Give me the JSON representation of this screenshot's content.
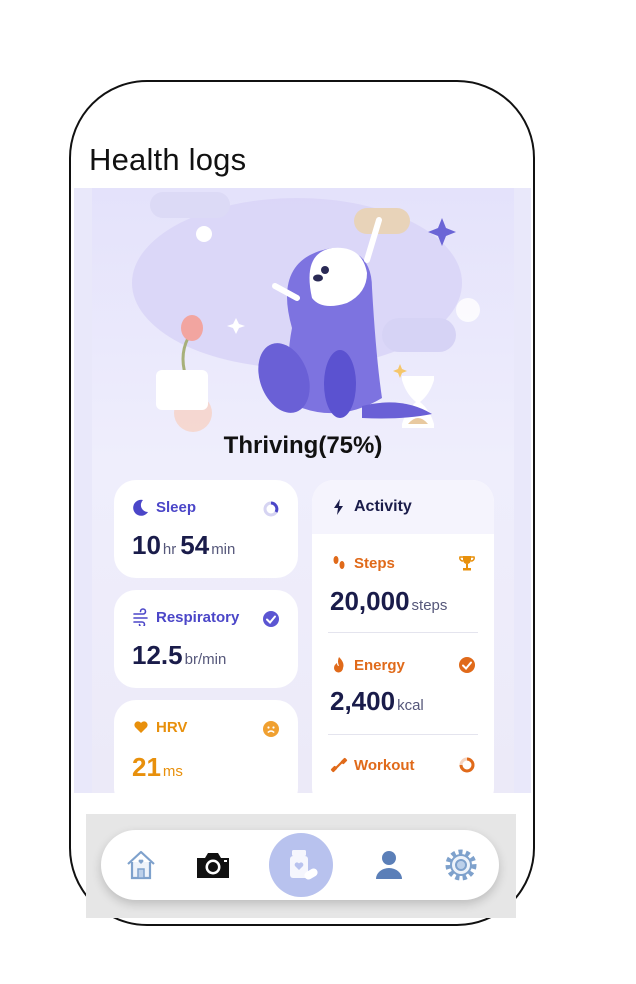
{
  "page": {
    "title": "Health logs"
  },
  "hero": {
    "status": "Thriving(75%)"
  },
  "cards": {
    "sleep": {
      "label": "Sleep",
      "hours": "10",
      "hours_unit": "hr",
      "minutes": "54",
      "minutes_unit": "min",
      "color": "#4b46c8"
    },
    "respiratory": {
      "label": "Respiratory",
      "value": "12.5",
      "unit": "br/min",
      "color": "#4b46c8"
    },
    "hrv": {
      "label": "HRV",
      "value": "21",
      "unit": "ms",
      "color": "#e8900c"
    }
  },
  "activity": {
    "label": "Activity",
    "steps": {
      "label": "Steps",
      "value": "20,000",
      "unit": "steps",
      "color": "#e06a1a"
    },
    "energy": {
      "label": "Energy",
      "value": "2,400",
      "unit": "kcal",
      "color": "#e06a1a"
    },
    "workout": {
      "label": "Workout",
      "color": "#e06a1a"
    }
  },
  "nav": {
    "items": [
      "home-icon",
      "camera-icon",
      "medicine-icon",
      "profile-icon",
      "settings-icon"
    ],
    "active": "medicine-icon"
  }
}
